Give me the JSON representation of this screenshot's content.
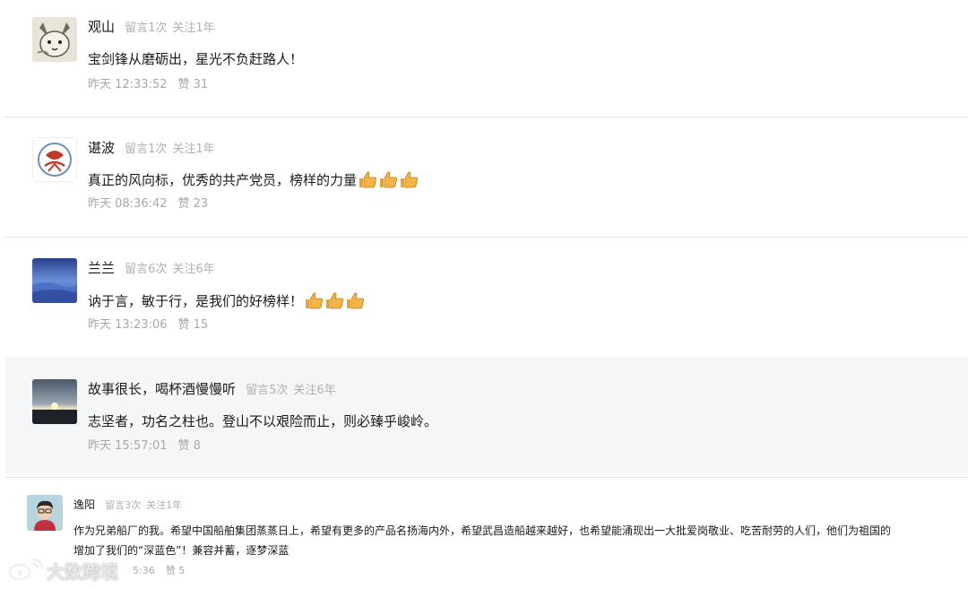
{
  "comments": [
    {
      "username": "观山",
      "messages": "留言1次",
      "following": "关注1年",
      "text": "宝剑锋从磨砺出，星光不负赶路人！",
      "time": "昨天 12:33:52",
      "likes": "赞 31",
      "thumbs": 0
    },
    {
      "username": "谌波",
      "messages": "留言1次",
      "following": "关注1年",
      "text": "真正的风向标，优秀的共产党员，榜样的力量",
      "time": "昨天 08:36:42",
      "likes": "赞 23",
      "thumbs": 3
    },
    {
      "username": "兰兰",
      "messages": "留言6次",
      "following": "关注6年",
      "text": "讷于言，敏于行，是我们的好榜样！",
      "time": "昨天 13:23:06",
      "likes": "赞 15",
      "thumbs": 3
    },
    {
      "username": "故事很长，喝杯酒慢慢听",
      "messages": "留言5次",
      "following": "关注6年",
      "text": "志坚者，功名之柱也。登山不以艰险而止，则必臻乎峻岭。",
      "time": "昨天 15:57:01",
      "likes": "赞 8",
      "thumbs": 0
    },
    {
      "username": "逸阳",
      "messages": "留言3次",
      "following": "关注1年",
      "text": "作为兄弟船厂的我。希望中国船舶集团蒸蒸日上，希望有更多的产品名扬海内外，希望武昌造船越来越好，也希望能涌现出一大批爱岗敬业、吃苦耐劳的人们，他们为祖国的增加了我们的“深蓝色”！兼容并蓄，逐梦深蓝",
      "time": "5:36",
      "likes": "赞 5",
      "thumbs": 0
    }
  ],
  "watermark": "大数跨境",
  "colors": {
    "username": "#1a1a1a",
    "meta": "#b0b0b0",
    "highlight_bg": "#f5f6f8",
    "divider": "#e3e3e3"
  },
  "icons": {
    "thumbs": "thumbs-up-emoji-icon",
    "watermark_logo": "weibo-logo-icon"
  }
}
